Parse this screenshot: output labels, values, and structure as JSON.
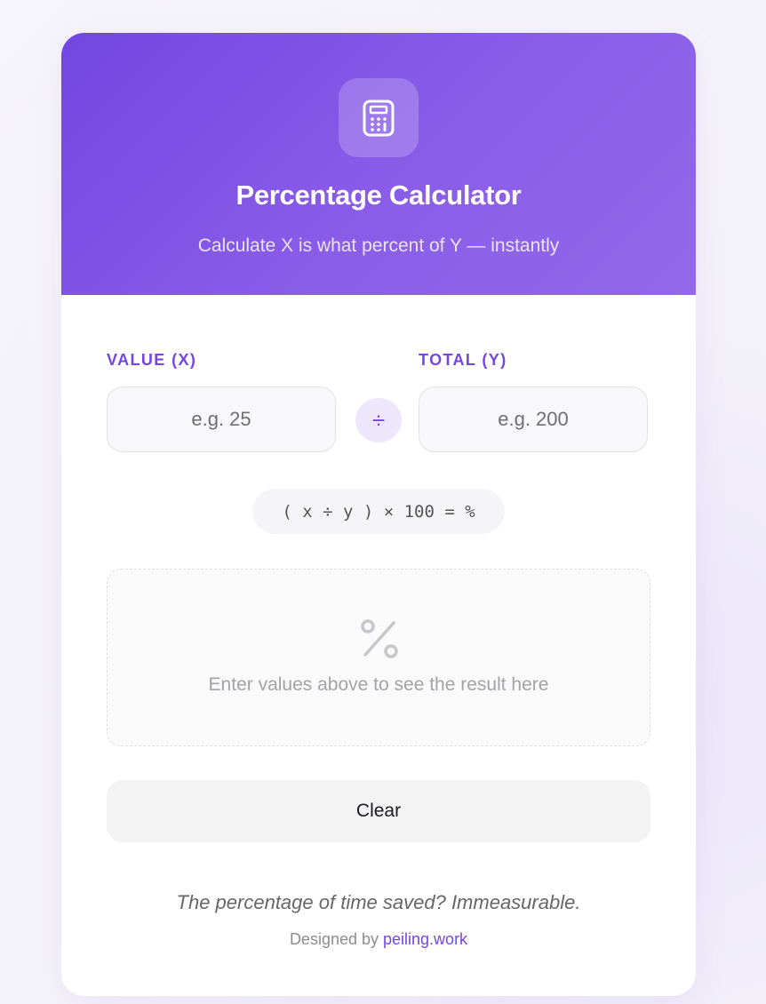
{
  "header": {
    "title": "Percentage Calculator",
    "subtitle": "Calculate X is what percent of Y — instantly",
    "icon": "calculator-icon",
    "accent_color": "#7446e2"
  },
  "form": {
    "value_label": "VALUE (X)",
    "value_placeholder": "e.g. 25",
    "value_current": "",
    "total_label": "TOTAL (Y)",
    "total_placeholder": "e.g. 200",
    "total_current": "",
    "operator_symbol": "÷",
    "formula": "( x ÷ y ) × 100 = %"
  },
  "result": {
    "icon": "percent-icon",
    "empty_message": "Enter values above to see the result here"
  },
  "actions": {
    "clear_label": "Clear"
  },
  "footer": {
    "tagline": "The percentage of time saved? Immeasurable.",
    "credit_prefix": "Designed by ",
    "credit_link": "peiling.work"
  }
}
